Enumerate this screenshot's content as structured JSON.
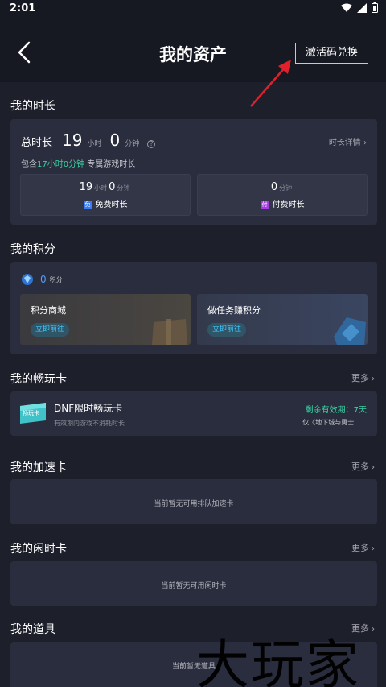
{
  "status_bar": {
    "time": "2:01"
  },
  "header": {
    "title": "我的资产",
    "redeem_button": "激活码兑换"
  },
  "time_section": {
    "title": "我的时长",
    "total_label": "总时长",
    "hours": "19",
    "hours_unit": "小时",
    "minutes": "0",
    "minutes_unit": "分钟",
    "detail_link": "时长详情",
    "include_prefix": "包含",
    "include_highlight": "17小时0分钟",
    "include_suffix": "专属游戏时长",
    "free": {
      "hours": "19",
      "hours_unit": "小时",
      "minutes": "0",
      "minutes_unit": "分钟",
      "badge": "免",
      "label": "免费时长"
    },
    "paid": {
      "minutes": "0",
      "minutes_unit": "分钟",
      "badge": "付",
      "label": "付费时长"
    }
  },
  "points_section": {
    "title": "我的积分",
    "points": "0",
    "points_unit": "积分",
    "mall": {
      "name": "积分商城",
      "button": "立即前往"
    },
    "tasks": {
      "name": "做任务赚积分",
      "button": "立即前往"
    }
  },
  "pass_section": {
    "title": "我的畅玩卡",
    "more": "更多",
    "card": {
      "image_text": "畅玩卡",
      "name": "DNF限时畅玩卡",
      "desc": "有效期内游戏不消耗时长",
      "remain": "剩余有效期：7天",
      "scope": "仅《地下城与勇士:…"
    }
  },
  "accel_section": {
    "title": "我的加速卡",
    "more": "更多",
    "empty": "当前暂无可用排队加速卡"
  },
  "idle_section": {
    "title": "我的闲时卡",
    "more": "更多",
    "empty": "当前暂无可用闲时卡"
  },
  "props_section": {
    "title": "我的道具",
    "more": "更多",
    "empty": "当前暂无道具"
  },
  "watermark": "大玩家",
  "colors": {
    "accent_green": "#39d3a3",
    "accent_blue": "#4f9cff",
    "annotation_red": "#e0202a",
    "background": "#1d1f2b",
    "card": "#2a2d3d"
  }
}
